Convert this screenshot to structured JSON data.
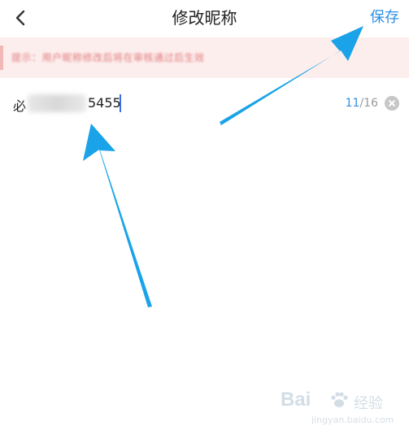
{
  "header": {
    "title": "修改昵称",
    "save_label": "保存"
  },
  "notice": {
    "text": "提示：用户昵称修改后将在审核通过后生效"
  },
  "nickname_field": {
    "prefix": "必",
    "suffix": "5455",
    "count_current": "11",
    "count_max": "/16"
  },
  "watermark": {
    "logo": "Bai",
    "brand": "经验",
    "url": "jingyan.baidu.com"
  },
  "colors": {
    "accent": "#2f8fe6",
    "annotation_arrow": "#1aa3e8",
    "notice_bg": "#fdeeee"
  },
  "icons": {
    "back": "chevron-left-icon",
    "clear": "clear-circle-icon"
  }
}
